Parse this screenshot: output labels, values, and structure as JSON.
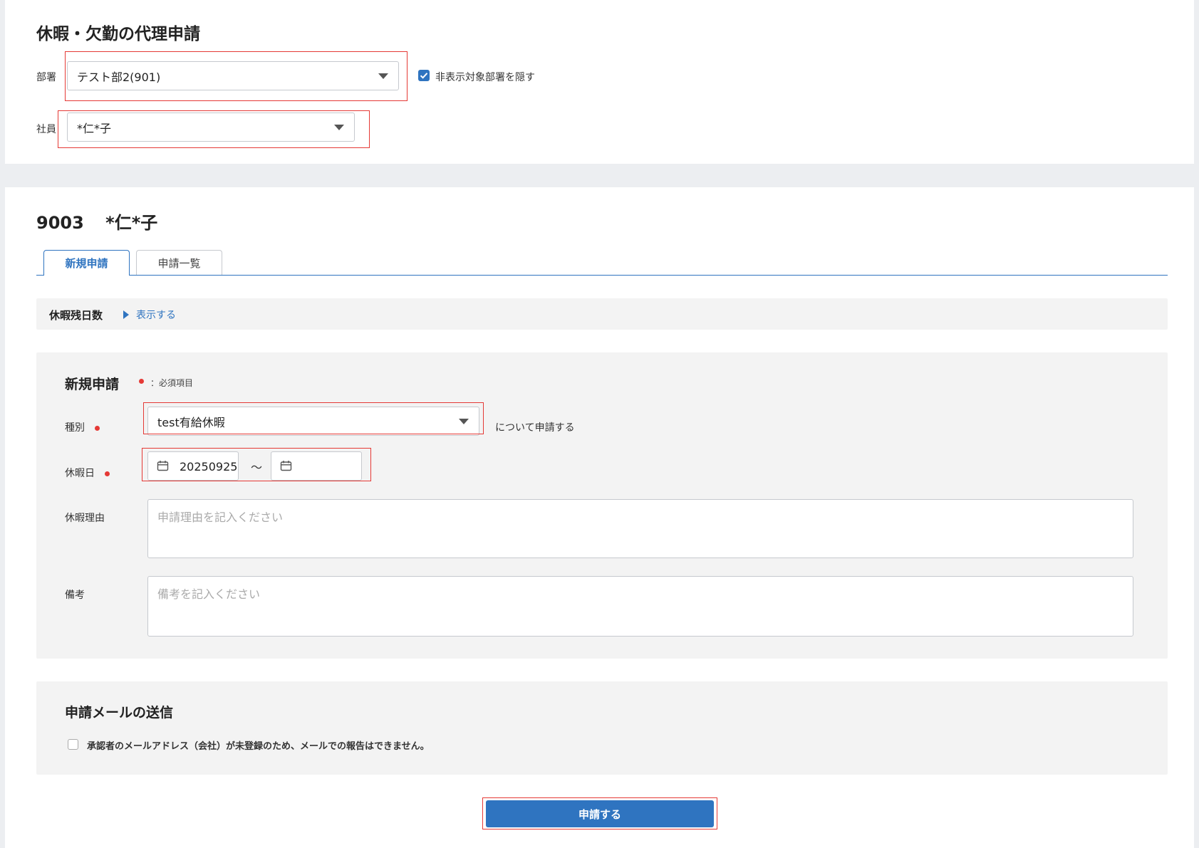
{
  "header": {
    "title": "休暇・欠勤の代理申請",
    "department_label": "部署",
    "department_value": "テスト部2(901)",
    "hide_checkbox_label": "非表示対象部署を隠す",
    "hide_checkbox_checked": true,
    "employee_label": "社員",
    "employee_value": "*仁*子"
  },
  "employee": {
    "code": "9003",
    "name": "*仁*子"
  },
  "tabs": [
    {
      "label": "新規申請",
      "active": true
    },
    {
      "label": "申請一覧",
      "active": false
    }
  ],
  "balance": {
    "label": "休暇残日数",
    "toggle": "表示する"
  },
  "form": {
    "title": "新規申請",
    "required_note": "：必須項目",
    "type_label": "種別",
    "type_value": "test有給休暇",
    "type_suffix": "について申請する",
    "date_label": "休暇日",
    "date_from": "20250925",
    "date_separator": "～",
    "date_to": "",
    "reason_label": "休暇理由",
    "reason_placeholder": "申請理由を記入ください",
    "note_label": "備考",
    "note_placeholder": "備考を記入ください"
  },
  "mail": {
    "title": "申請メールの送信",
    "checkbox_label": "承認者のメールアドレス（会社）が未登録のため、メールでの報告はできません。",
    "checked": false
  },
  "submit_label": "申請する",
  "colors": {
    "accent": "#2f74c0",
    "required": "#e53935",
    "highlight_frame": "#e53935"
  }
}
